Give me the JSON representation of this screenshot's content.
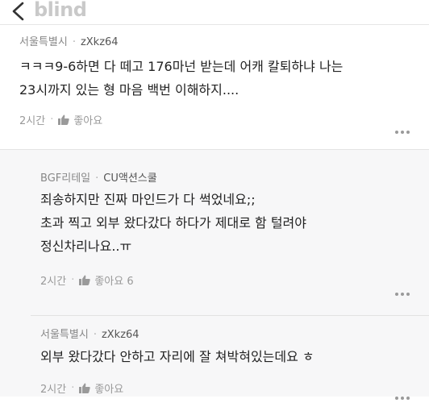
{
  "app": {
    "brand": "blind"
  },
  "comments": [
    {
      "company": "서울특별시",
      "nickname": "zXkz64",
      "lines": [
        "ㅋㅋㅋ9-6하면 다 떼고 176마넌 받는데 어캐 칼퇴하냐 나는",
        "23시까지 있는 형 마음 백번 이해하지...."
      ],
      "time": "2시간",
      "like_label": "좋아요"
    }
  ],
  "replies": [
    {
      "company": "BGF리테일",
      "nickname": "CU액션스쿨",
      "lines": [
        "죄송하지만 진짜 마인드가 다 썩었네요;;",
        "초과 찍고 외부 왔다갔다 하다가 제대로 함 털려야",
        "정신차리나요..ㅠ"
      ],
      "time": "2시간",
      "like_label": "좋아요 6"
    },
    {
      "company": "서울특별시",
      "nickname": "zXkz64",
      "lines": [
        "외부 왔다갔다 안하고 자리에 잘 쳐박혀있는데요 ㅎ"
      ],
      "time": "2시간",
      "like_label": "좋아요"
    }
  ]
}
